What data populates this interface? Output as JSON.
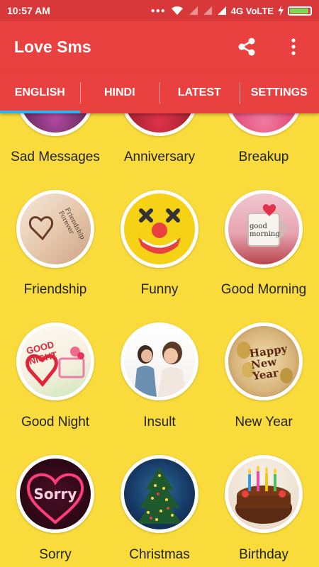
{
  "status_bar": {
    "time": "10:57 AM",
    "network": "4G VoLTE",
    "icons": [
      "dots-icon",
      "wifi-icon",
      "signal-icon",
      "signal-icon",
      "charging-icon",
      "battery-icon"
    ],
    "battery_level": 0.85
  },
  "app_bar": {
    "title": "Love Sms",
    "share_icon": "share-icon",
    "menu_icon": "more-vert-icon"
  },
  "tabs": [
    {
      "label": "ENGLISH",
      "active": true
    },
    {
      "label": "HINDI",
      "active": false
    },
    {
      "label": "LATEST",
      "active": false
    },
    {
      "label": "SETTINGS",
      "active": false
    }
  ],
  "categories": [
    {
      "label": "Sad Messages"
    },
    {
      "label": "Anniversary"
    },
    {
      "label": "Breakup"
    },
    {
      "label": "Friendship"
    },
    {
      "label": "Funny"
    },
    {
      "label": "Good Morning"
    },
    {
      "label": "Good Night"
    },
    {
      "label": "Insult"
    },
    {
      "label": "New Year"
    },
    {
      "label": "Sorry"
    },
    {
      "label": "Christmas"
    },
    {
      "label": "Birthday"
    }
  ],
  "image_text": {
    "friendship": "Friendship Forever",
    "good_morning": "good morning",
    "good_night": "GOOD NIGHT",
    "new_year": "Happy New Year",
    "sorry": "Sorry"
  },
  "colors": {
    "status_bar": "#d9383a",
    "app_bar": "#e8413f",
    "tab_indicator": "#29b6f6",
    "background": "#f9dc3c"
  }
}
